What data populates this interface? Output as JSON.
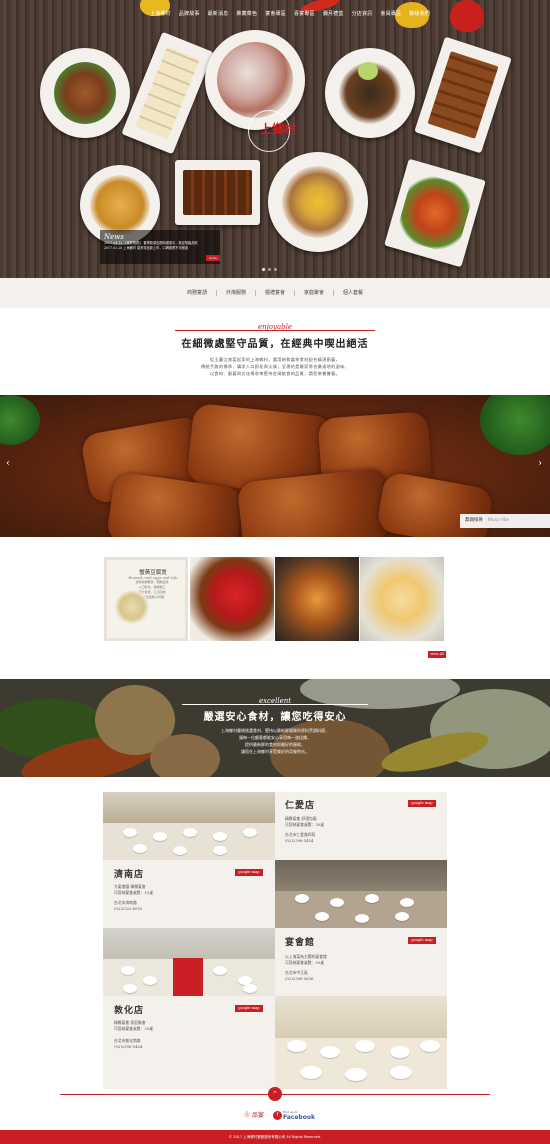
{
  "nav": {
    "items": [
      "上海鄉村",
      "品牌故事",
      "最新消息",
      "推薦菜色",
      "宴會專區",
      "喜宴專區",
      "彌月禮盒",
      "分店資訊",
      "會員專區",
      "聯絡我們"
    ]
  },
  "hero": {
    "logo_text": "上鄉村",
    "logo_sub": "SHANGHAI VILLAGE",
    "news": {
      "title": "News",
      "lines": [
        "2017.04.12 【推薦推薦】 春季新菜色限時優惠中，歡迎蒞臨品嚐",
        "2017.03.28 上海鄉村 菜系特色新上市，口碑推薦不可錯過"
      ],
      "more_label": "more"
    }
  },
  "subnav": {
    "items": [
      "商務宴請",
      "外燴服務",
      "婚禮宴會",
      "家庭聚會",
      "個人套餐"
    ]
  },
  "intro": {
    "en": "enjoyable",
    "title": "在細微處堅守品質，在經典中喫出絕活",
    "paragraphs": [
      "從玉蘭江南菜起家的上海鄉村，選用新鮮當季食材配合精湛廚藝，",
      "傳統手路的傳承，講求入口即化與火候，呈現的是最家常也最道地的滋味，",
      "以食材、廚藝與文化傳承來堅持台灣飲食的品質，請您來嘗嘗看。"
    ]
  },
  "banner": {
    "caption_zh": "無錫排骨",
    "caption_en": "Wuxi ribs"
  },
  "menu_card": {
    "title": "蟹黃豆腐煲",
    "subtitle": "Braised crab eggs and tofu",
    "lines": [
      "選用新鮮蟹黃，細嫩豆腐",
      "入口即化，滑嫩爽口",
      "湯汁香濃，口口回味",
      "冬季最佳暖心料理"
    ]
  },
  "view_all": "view all",
  "veg": {
    "en": "excellent",
    "title": "嚴選安心食材，讓您吃得安心",
    "paragraphs": [
      "上海鄉村嚴格挑選食材，堅持以最新鮮優質的原料烹調料理，",
      "讓每一位顧客都能安心享用每一道佳餚，",
      "提供最新鮮的食材與最好的服務，",
      "讓您在上海鄉村享受美好的用餐時光。"
    ]
  },
  "branches": [
    {
      "name": "仁愛店",
      "lines": [
        "精緻宴會 舒適包廂",
        "可容納宴會桌數：30桌",
        "台北市仁愛路四段",
        "(02)2396-5454"
      ]
    },
    {
      "name": "濟南店",
      "lines": [
        "大宴會廳 精緻宴會",
        "可容納宴會桌數：15桌",
        "台北市濟南路",
        "(02)2322-6555"
      ]
    },
    {
      "name": "宴會館",
      "lines": [
        "以上海菜為主題的宴會館",
        "可容納宴會桌數：50桌",
        "台北市中正區",
        "(02)2396-5656"
      ]
    },
    {
      "name": "敦化店",
      "lines": [
        "精緻宴會 家庭聚會",
        "可容納宴會桌數：20桌",
        "台北市敦化南路",
        "(02)2396-5454"
      ]
    }
  ],
  "gmap_label": "google map",
  "footer": {
    "brand": "品宴",
    "fb_find": "Find us on",
    "fb_name": "Facebook",
    "copyright": "© 2017 上海鄉村餐飲股份有限公司 All Rights Reserved."
  },
  "colors": {
    "accent": "#c81f24",
    "facebook": "#3b5998"
  }
}
